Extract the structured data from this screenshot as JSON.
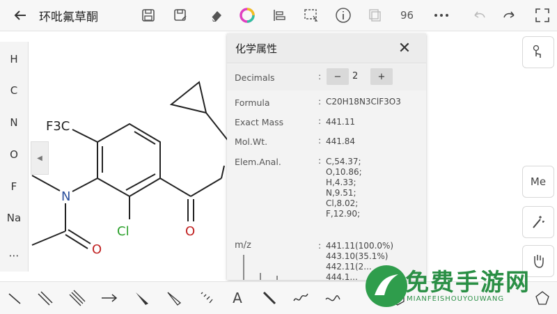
{
  "topbar": {
    "title": "环吡氟草酮",
    "zoom": "96",
    "icons": [
      "back-arrow-icon",
      "save-icon",
      "save-as-icon",
      "eraser-icon",
      "color-wheel-icon",
      "align-icon",
      "lasso-select-icon",
      "info-icon",
      "copy-icon",
      "more-icon",
      "undo-icon",
      "redo-icon",
      "fullscreen-icon"
    ]
  },
  "elements": [
    "H",
    "C",
    "N",
    "O",
    "F",
    "Na",
    "⋯"
  ],
  "molecule": {
    "labels": {
      "cf3": "F3C",
      "n": "N",
      "o1": "O",
      "o2": "O",
      "cl": "Cl"
    },
    "colors": {
      "bond": "#222222",
      "nitrogen": "#2b4f9b",
      "oxygen": "#c02020",
      "chlorine": "#2aa02a"
    }
  },
  "right_tools": {
    "me": "Me"
  },
  "panel": {
    "title": "化学属性",
    "decimals": {
      "label": "Decimals",
      "minus": "−",
      "value": "2",
      "plus": "+"
    },
    "rows": [
      {
        "label": "Formula",
        "value": "C20H18N3ClF3O3"
      },
      {
        "label": "Exact Mass",
        "value": "441.11"
      },
      {
        "label": "Mol.Wt.",
        "value": "441.84"
      },
      {
        "label": "Elem.Anal.",
        "value": [
          "C,54.37;",
          "O,10.86;",
          "H,4.33;",
          "N,9.51;",
          "Cl,8.02;",
          "F,12.90;"
        ]
      },
      {
        "label": "m/z",
        "value": [
          "441.11(100.0%)",
          "443.10(35.1%)",
          "442.11(2...",
          "444.1..."
        ]
      }
    ]
  },
  "watermark": {
    "title": "免费手游网",
    "subtitle": "MIANFEISHOUYOUWANG"
  }
}
